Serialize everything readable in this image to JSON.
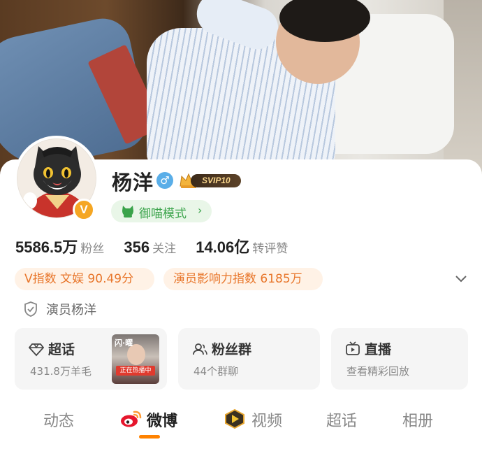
{
  "profile": {
    "name": "杨洋",
    "gender_icon": "male-icon",
    "vip_label": "SVIP10",
    "verified_badge": "V",
    "mode_label": "御喵模式",
    "mode_chevron": "›",
    "verification": "演员杨洋"
  },
  "stats": [
    {
      "value": "5586.5万",
      "label": "粉丝"
    },
    {
      "value": "356",
      "label": "关注"
    },
    {
      "value": "14.06亿",
      "label": "转评赞"
    }
  ],
  "tags": {
    "v_index": "V指数 文娱 90.49分",
    "actor_index": "演员影响力指数 6185万"
  },
  "cards": {
    "chaohua": {
      "title": "超话",
      "sub": "431.8万羊毛",
      "poster_title": "闪·曜",
      "poster_live": "正在热播中"
    },
    "fans": {
      "title": "粉丝群",
      "sub": "44个群聊"
    },
    "live": {
      "title": "直播",
      "sub": "查看精彩回放"
    }
  },
  "tabs": [
    {
      "label": "动态"
    },
    {
      "label": "微博",
      "active": true
    },
    {
      "label": "视频"
    },
    {
      "label": "超话"
    },
    {
      "label": "相册"
    }
  ],
  "colors": {
    "accent_orange": "#ff8200",
    "tag_text": "#e8762b",
    "tag_bg": "#fff2e6",
    "mode_green": "#3aa34a",
    "mode_bg": "#e9f6e8",
    "gender_blue": "#5aaee8",
    "verified_gold": "#f5a623"
  }
}
